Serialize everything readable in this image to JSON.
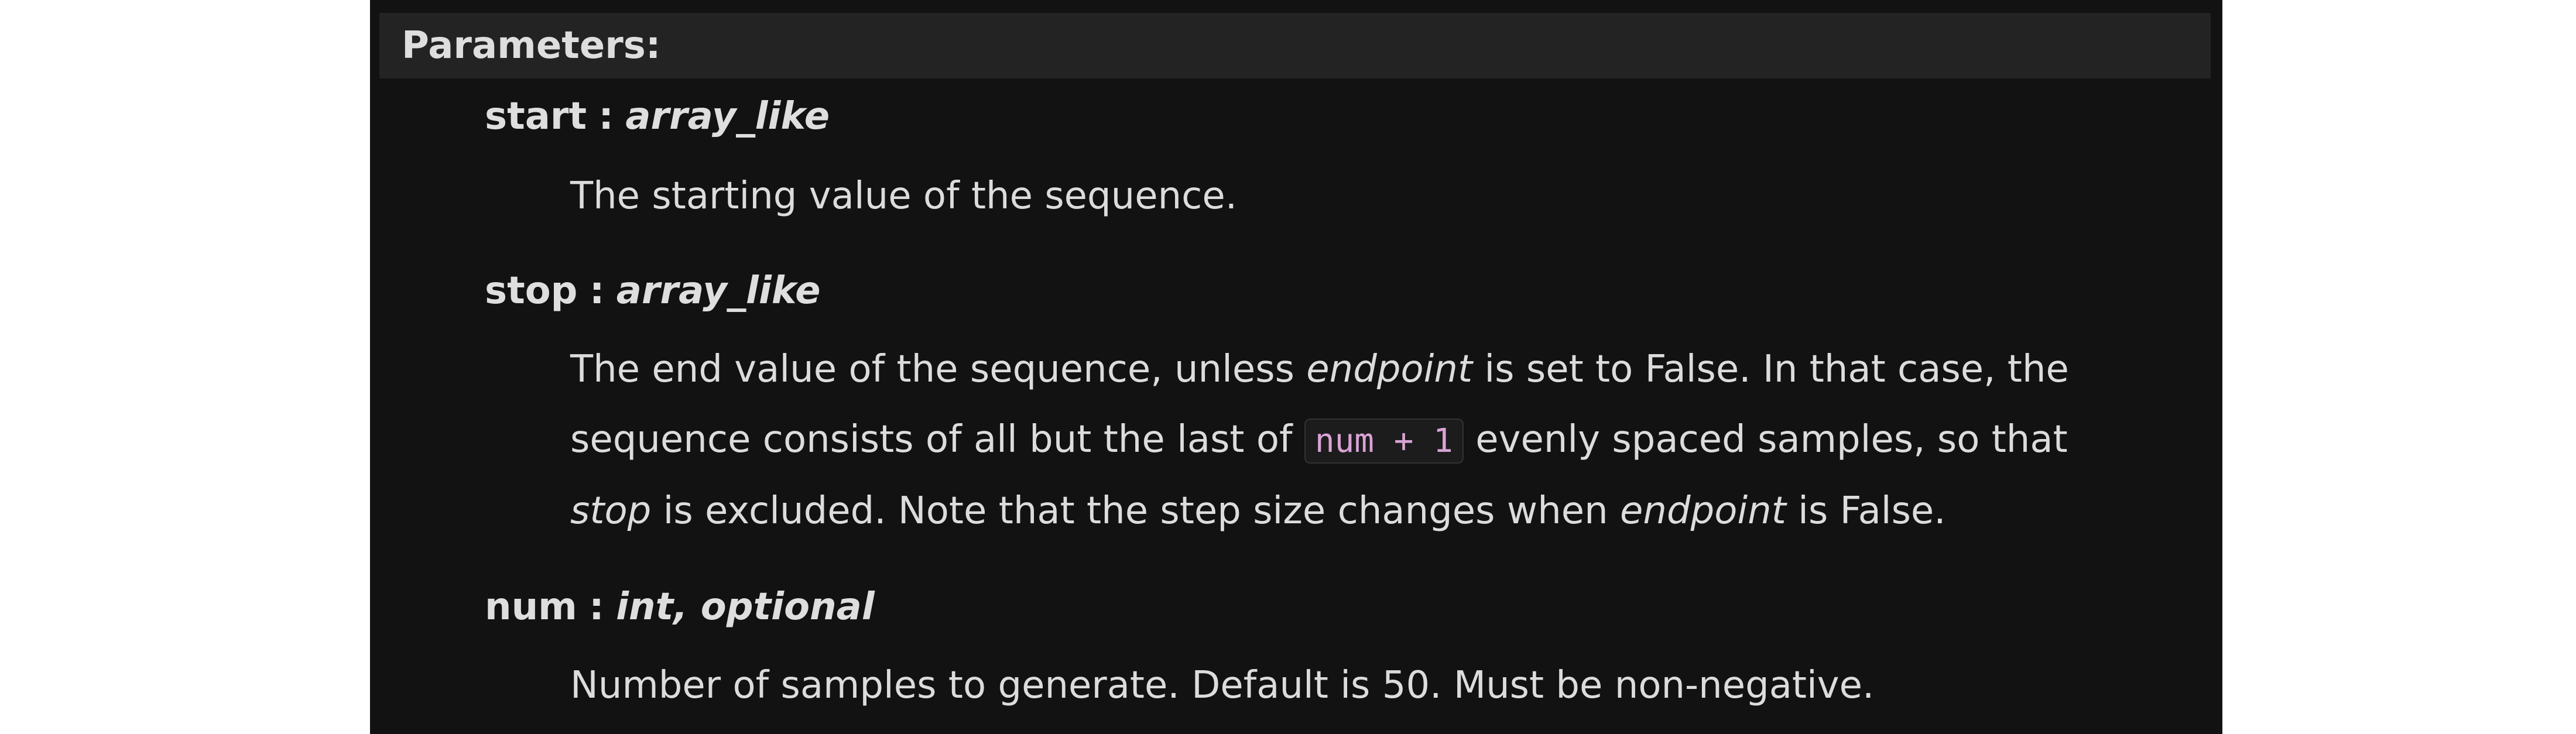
{
  "section_title": "Parameters:",
  "params": [
    {
      "name": "start",
      "sep": ":",
      "type": "array_like",
      "desc": "The starting value of the sequence."
    },
    {
      "name": "stop",
      "sep": ":",
      "type": "array_like",
      "desc_lines": [
        {
          "t1": "The end value of the sequence, unless ",
          "em": "endpoint",
          "t2": " is set to False. In that case, the"
        },
        {
          "t1": "sequence consists of all but the last of ",
          "code": "num + 1",
          "t2": " evenly spaced samples, so that"
        },
        {
          "em1": "stop",
          "t1": " is excluded. Note that the step size changes when ",
          "em2": "endpoint",
          "t2": " is False."
        }
      ]
    },
    {
      "name": "num",
      "sep": ":",
      "type": "int, optional",
      "desc": "Number of samples to generate. Default is 50. Must be non-negative."
    }
  ]
}
